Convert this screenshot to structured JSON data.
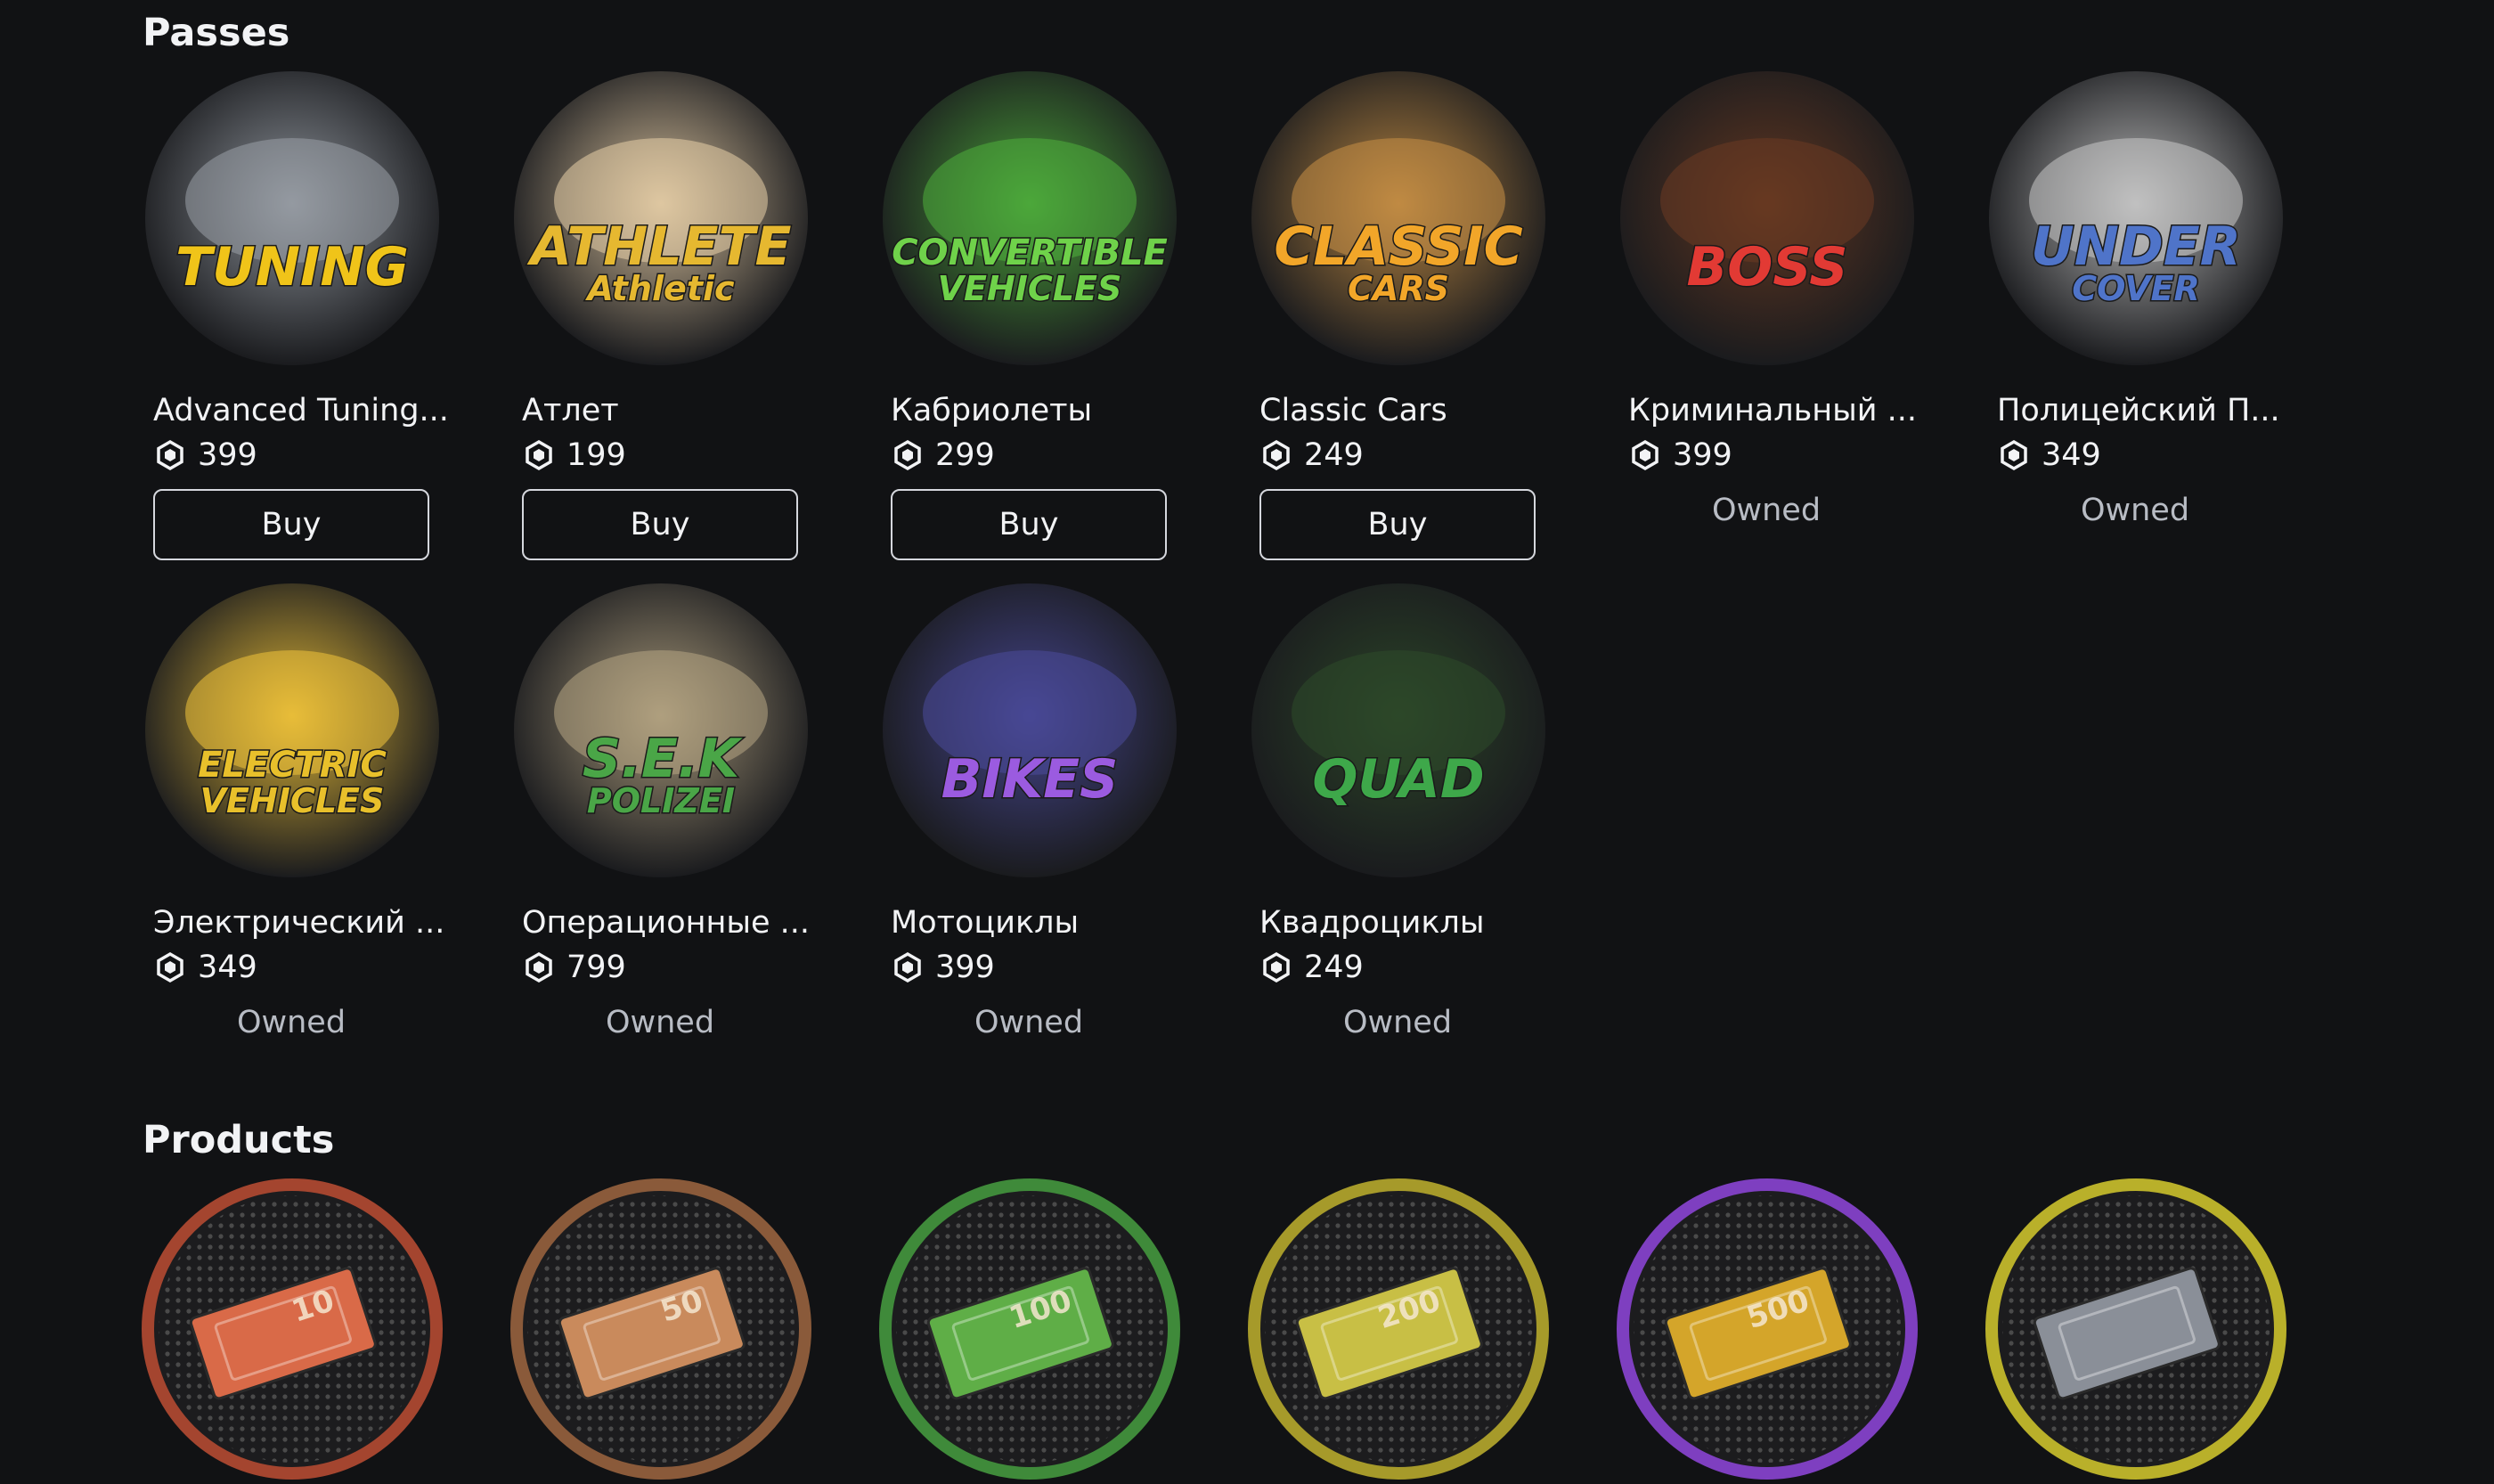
{
  "sections": {
    "passes_title": "Passes",
    "products_title": "Products"
  },
  "passes": [
    {
      "name": "Advanced Tuning...",
      "price": "399",
      "action": "Buy",
      "state": "buy",
      "art_text": "TUNING",
      "art_sub": "",
      "accent": "#f0c419",
      "bg": "#9aa0a8"
    },
    {
      "name": "Атлет",
      "price": "199",
      "action": "Buy",
      "state": "buy",
      "art_text": "ATHLETE",
      "art_sub": "Athletic",
      "accent": "#e6b830",
      "bg": "#e8cfa8"
    },
    {
      "name": "Кабриолеты",
      "price": "299",
      "action": "Buy",
      "state": "buy",
      "art_text": "CONVERTIBLE",
      "art_sub": "VEHICLES",
      "accent": "#6fd24a",
      "bg": "#4fae3c"
    },
    {
      "name": "Classic Cars",
      "price": "249",
      "action": "Buy",
      "state": "buy",
      "art_text": "CLASSIC",
      "art_sub": "CARS",
      "accent": "#f2a629",
      "bg": "#c89045"
    },
    {
      "name": "Криминальный ...",
      "price": "399",
      "action": "Owned",
      "state": "owned",
      "art_text": "BOSS",
      "art_sub": "",
      "accent": "#e23a34",
      "bg": "#6b3b22"
    },
    {
      "name": "Полицейский П...",
      "price": "349",
      "action": "Owned",
      "state": "owned",
      "art_text": "UNDER",
      "art_sub": "COVER",
      "accent": "#4f74c9",
      "bg": "#c9c9c9"
    },
    {
      "name": "Электрический ...",
      "price": "349",
      "action": "Owned",
      "state": "owned",
      "art_text": "ELECTRIC",
      "art_sub": "VEHICLES",
      "accent": "#e8c02b",
      "bg": "#f2c53a"
    },
    {
      "name": "Операционные ...",
      "price": "799",
      "action": "Owned",
      "state": "owned",
      "art_text": "S.E.K",
      "art_sub": "POLIZEI",
      "accent": "#4aa647",
      "bg": "#b7a684"
    },
    {
      "name": "Мотоциклы",
      "price": "399",
      "action": "Owned",
      "state": "owned",
      "art_text": "BIKES",
      "art_sub": "",
      "accent": "#9b5be0",
      "bg": "#4a4a9a"
    },
    {
      "name": "Квадроциклы",
      "price": "249",
      "action": "Owned",
      "state": "owned",
      "art_text": "QUAD",
      "art_sub": "",
      "accent": "#3ea84a",
      "bg": "#2e4a2a"
    }
  ],
  "products": [
    {
      "ring": "#a4452f",
      "bill": "#d96a48",
      "label": "10"
    },
    {
      "ring": "#8a5a3a",
      "bill": "#c98a5c",
      "label": "50"
    },
    {
      "ring": "#3f8a3a",
      "bill": "#5fae47",
      "label": "100"
    },
    {
      "ring": "#a69a2a",
      "bill": "#c8bf45",
      "label": "200"
    },
    {
      "ring": "#7e3fc0",
      "bill": "#d4a52a",
      "label": "500"
    },
    {
      "ring": "#b9b02a",
      "bill": "#8a8f98",
      "label": ""
    }
  ],
  "icons": {
    "currency": "robux-icon"
  }
}
